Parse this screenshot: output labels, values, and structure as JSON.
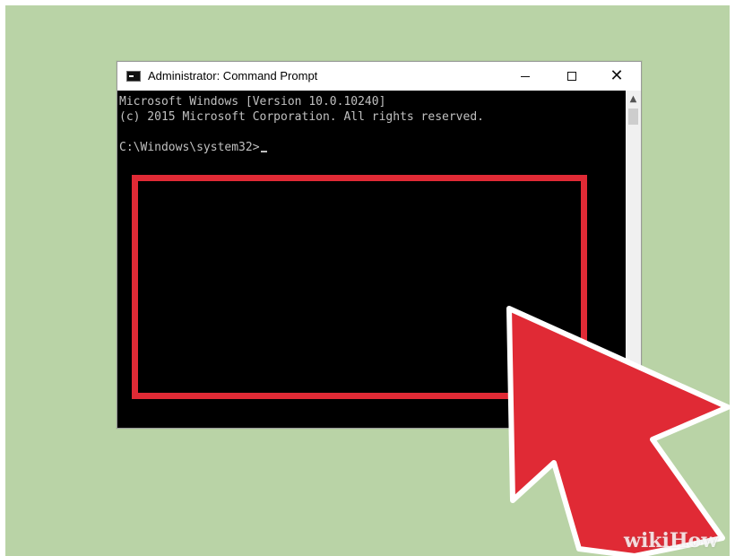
{
  "window": {
    "title": "Administrator: Command Prompt",
    "icon": "cmd-icon",
    "controls": {
      "minimize": "minimize-icon",
      "maximize": "maximize-icon",
      "close": "close-icon"
    }
  },
  "console": {
    "lines": [
      "Microsoft Windows [Version 10.0.10240]",
      "(c) 2015 Microsoft Corporation. All rights reserved."
    ],
    "prompt": "C:\\Windows\\system32>"
  },
  "colors": {
    "background": "#b9d3a6",
    "console_bg": "#000000",
    "console_text": "#c0c0c0",
    "highlight": "#e02a35"
  },
  "watermark": "wikiHow"
}
